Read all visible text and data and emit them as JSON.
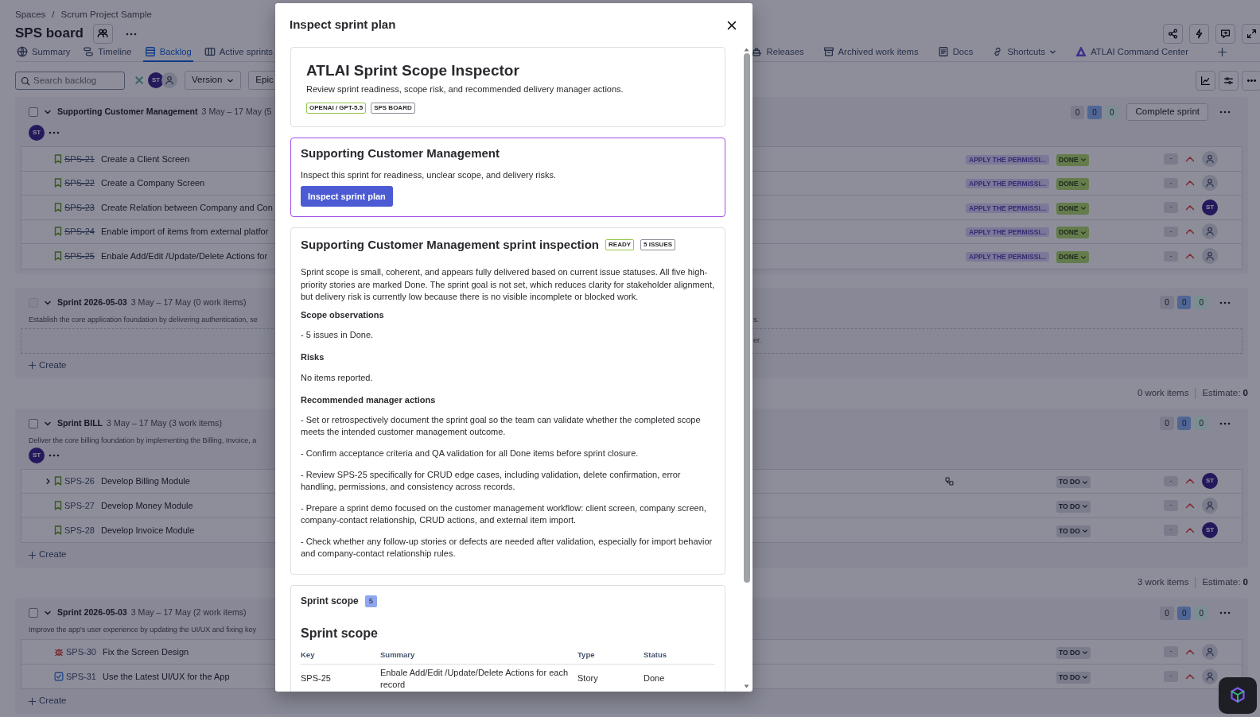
{
  "breadcrumbs": [
    "Spaces",
    "Scrum Project Sample"
  ],
  "breadcrumb_separator": "/",
  "board_title": "SPS board",
  "tabs_left": [
    {
      "label": "Summary",
      "selected": false
    },
    {
      "label": "Timeline",
      "selected": false
    },
    {
      "label": "Backlog",
      "selected": true
    },
    {
      "label": "Active sprints",
      "selected": false
    }
  ],
  "tabs_right": [
    {
      "label": "Releases",
      "selected": false
    },
    {
      "label": "Archived work items",
      "selected": false
    },
    {
      "label": "Docs",
      "selected": false
    },
    {
      "label": "Shortcuts",
      "selected": false,
      "dropdown": true
    },
    {
      "label": "ATLAI Command Center",
      "selected": false,
      "dropdown": false
    }
  ],
  "toolbar": {
    "search": {
      "placeholder": "Search backlog"
    },
    "avatars": [
      "ST"
    ],
    "filters": [
      {
        "label": "Version",
        "dropdown": true
      },
      {
        "label": "Epic",
        "dropdown": false
      }
    ]
  },
  "sprints": [
    {
      "name": "Supporting Customer Management",
      "dates": "3 May – 17 May (5",
      "expanded": true,
      "checkbox": {
        "checked": false,
        "disabled": false
      },
      "members": [
        "ST"
      ],
      "counts": [
        "0",
        "0",
        "0"
      ],
      "action": "Complete sprint",
      "rows": [
        {
          "kind": "story",
          "key": "SPS-21",
          "summary": "Create a Client Screen",
          "done": true,
          "expandable": false,
          "epic": "APPLY THE PERMISSI...",
          "status": "DONE",
          "estimate": "-"
        },
        {
          "kind": "story",
          "key": "SPS-22",
          "summary": "Create a Company Screen",
          "done": true,
          "expandable": false,
          "epic": "APPLY THE PERMISSI...",
          "status": "DONE",
          "estimate": "-"
        },
        {
          "kind": "story",
          "key": "SPS-23",
          "summary": "Create Relation between Company and Con",
          "done": true,
          "expandable": false,
          "epic": "APPLY THE PERMISSI...",
          "status": "DONE",
          "estimate": "-",
          "assignee": "ST"
        },
        {
          "kind": "story",
          "key": "SPS-24",
          "summary": "Enable import of items from external platfor",
          "done": true,
          "expandable": false,
          "epic": "APPLY THE PERMISSI...",
          "status": "DONE",
          "estimate": "-"
        },
        {
          "kind": "story",
          "key": "SPS-25",
          "summary": "Enbale Add/Edit /Update/Delete Actions for",
          "done": true,
          "expandable": false,
          "epic": "APPLY THE PERMISSI...",
          "status": "DONE",
          "estimate": "-"
        }
      ]
    },
    {
      "name": "Sprint 2026-05-03",
      "dates": "3 May – 17 May (0 work items)",
      "expanded": true,
      "checkbox": {
        "checked": false,
        "disabled": true
      },
      "description": "Establish the core application foundation by delivering authentication, se",
      "description_tail": "s.",
      "counts": [
        "0",
        "0",
        "0"
      ],
      "drop_zone": "er.",
      "create": "Create",
      "footer": {
        "count": "0 work items",
        "estimate_label": "Estimate:",
        "estimate": "0"
      }
    },
    {
      "name": "Sprint BILL",
      "dates": "3 May – 17 May (3 work items)",
      "expanded": true,
      "checkbox": {
        "checked": false,
        "disabled": false
      },
      "description": "Deliver the core billing foundation by implementing the Billing, Invoice, a",
      "members": [
        "ST"
      ],
      "counts": [
        "0",
        "0",
        "0"
      ],
      "rows": [
        {
          "kind": "story",
          "key": "SPS-26",
          "summary": "Develop Billing Module",
          "done": false,
          "expandable": true,
          "status": "TO DO",
          "estimate": "-",
          "assignee": "ST"
        },
        {
          "kind": "story",
          "key": "SPS-27",
          "summary": "Develop Money Module",
          "done": false,
          "expandable": false,
          "status": "TO DO",
          "estimate": "-"
        },
        {
          "kind": "story",
          "key": "SPS-28",
          "summary": "Develop Invoice Module",
          "done": false,
          "expandable": false,
          "status": "TO DO",
          "estimate": "-",
          "assignee": "ST"
        }
      ],
      "create": "Create",
      "footer": {
        "count": "3 work items",
        "estimate_label": "Estimate:",
        "estimate": "0"
      }
    },
    {
      "name": "Sprint 2026-05-03",
      "dates": "3 May – 17 May (2 work items)",
      "expanded": true,
      "checkbox": {
        "checked": false,
        "disabled": false
      },
      "description": "Improve the app's user experience by updating the UI/UX and fixing key",
      "counts": [
        "0",
        "0",
        "0"
      ],
      "rows": [
        {
          "kind": "bug",
          "key": "SPS-30",
          "summary": "Fix the Screen Design",
          "done": false,
          "expandable": false,
          "status": "TO DO",
          "estimate": "-"
        },
        {
          "kind": "task",
          "key": "SPS-31",
          "summary": "Use the Latest UI/UX for the App",
          "done": false,
          "expandable": false,
          "status": "TO DO",
          "estimate": "-"
        }
      ],
      "create": "Create"
    }
  ],
  "modal": {
    "title": "Inspect sprint plan",
    "intro": {
      "title": "ATLAI Sprint Scope Inspector",
      "subtitle": "Review sprint readiness, scope risk, and recommended delivery manager actions.",
      "tags": [
        {
          "label": "OPENAI / GPT-5.5",
          "color": "#94c748"
        },
        {
          "label": "SPS BOARD",
          "color": "#8c8f97"
        }
      ]
    },
    "sprint_card": {
      "title": "Supporting Customer Management",
      "text": "Inspect this sprint for readiness, unclear scope, and delivery risks.",
      "button": "Inspect sprint plan"
    },
    "inspection": {
      "title": "Supporting Customer Management sprint inspection",
      "badges": [
        {
          "label": "READY",
          "color": "#94c748"
        },
        {
          "label": "5 ISSUES",
          "color": "#8c8f97"
        }
      ],
      "summary": "Sprint scope is small, coherent, and appears fully delivered based on current issue statuses. All five high-priority stories are marked Done. The sprint goal is not set, which reduces clarity for stakeholder alignment, but delivery risk is currently low because there is no visible incomplete or blocked work.",
      "sections": [
        {
          "heading": "Scope observations",
          "items": [
            "- 5 issues in Done."
          ]
        },
        {
          "heading": "Risks",
          "items": [
            "No items reported."
          ]
        },
        {
          "heading": "Recommended manager actions",
          "items": [
            "- Set or retrospectively document the sprint goal so the team can validate whether the completed scope meets the intended customer management outcome.",
            "- Confirm acceptance criteria and QA validation for all Done items before sprint closure.",
            "- Review SPS-25 specifically for CRUD edge cases, including validation, delete confirmation, error handling, permissions, and consistency across records.",
            "- Prepare a sprint demo focused on the customer management workflow: client screen, company screen, company-contact relationship, CRUD actions, and external item import.",
            "- Check whether any follow-up stories or defects are needed after validation, especially for import behavior and company-contact relationship rules."
          ]
        }
      ]
    },
    "scope": {
      "title": "Sprint scope",
      "count": "5",
      "table_title": "Sprint scope",
      "columns": [
        "Key",
        "Summary",
        "Type",
        "Status"
      ],
      "rows": [
        [
          "SPS-25",
          "Enbale Add/Edit /Update/Delete Actions for each record",
          "Story",
          "Done"
        ]
      ]
    }
  }
}
